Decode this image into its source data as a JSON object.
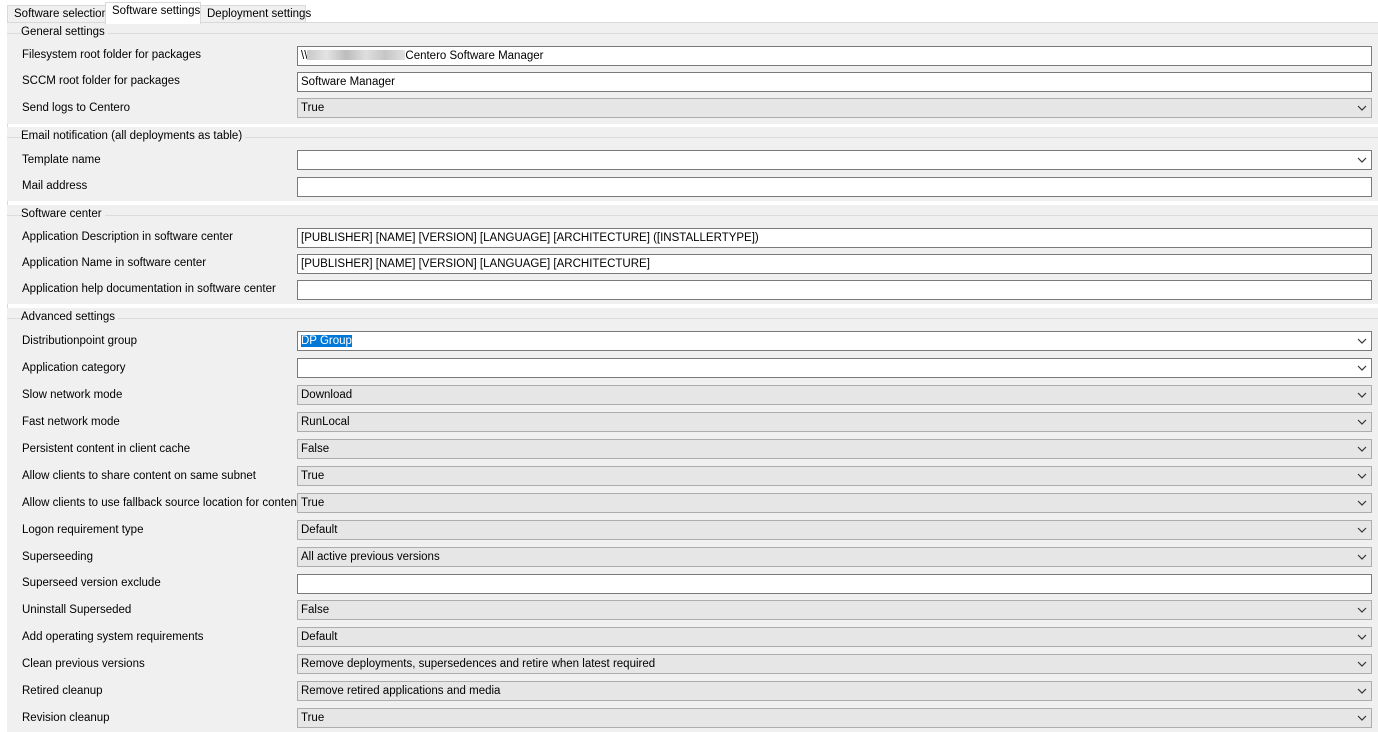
{
  "tabs": [
    "Software selection",
    "Software settings",
    "Deployment settings"
  ],
  "general": {
    "title": "General settings",
    "filesystem_label": "Filesystem root folder for packages",
    "filesystem_prefix": "\\\\",
    "filesystem_value": "Centero Software Manager",
    "sccm_label": "SCCM root folder for packages",
    "sccm_value": "Software Manager",
    "send_logs_label": "Send logs to Centero",
    "send_logs_value": "True"
  },
  "email": {
    "title": "Email notification (all deployments as table)",
    "template_label": "Template name",
    "template_value": "",
    "mail_label": "Mail address",
    "mail_value": ""
  },
  "software_center": {
    "title": "Software center",
    "desc_label": "Application Description in software center",
    "desc_value": "[PUBLISHER] [NAME] [VERSION] [LANGUAGE] [ARCHITECTURE] ([INSTALLERTYPE])",
    "name_label": "Application Name in software center",
    "name_value": "[PUBLISHER] [NAME] [VERSION] [LANGUAGE] [ARCHITECTURE]",
    "help_label": "Application help documentation in software center",
    "help_value": ""
  },
  "advanced": {
    "title": "Advanced settings",
    "dp_group_label": "Distributionpoint group",
    "dp_group_value": "DP Group",
    "category_label": "Application category",
    "category_value": "",
    "slow_label": "Slow network mode",
    "slow_value": "Download",
    "fast_label": "Fast network mode",
    "fast_value": "RunLocal",
    "persistent_label": "Persistent content in client cache",
    "persistent_value": "False",
    "share_label": "Allow clients to share content on same subnet",
    "share_value": "True",
    "fallback_label": "Allow clients to use fallback source location for content",
    "fallback_value": "True",
    "logon_label": "Logon requirement type",
    "logon_value": "Default",
    "superseeding_label": "Superseeding",
    "superseeding_value": "All active previous versions",
    "superseed_exclude_label": "Superseed version exclude",
    "superseed_exclude_value": "",
    "uninstall_label": "Uninstall Superseded",
    "uninstall_value": "False",
    "os_req_label": "Add operating system requirements",
    "os_req_value": "Default",
    "clean_label": "Clean previous versions",
    "clean_value": "Remove deployments, supersedences and retire when latest required",
    "retired_label": "Retired cleanup",
    "retired_value": "Remove retired applications and media",
    "revision_label": "Revision cleanup",
    "revision_value": "True"
  }
}
